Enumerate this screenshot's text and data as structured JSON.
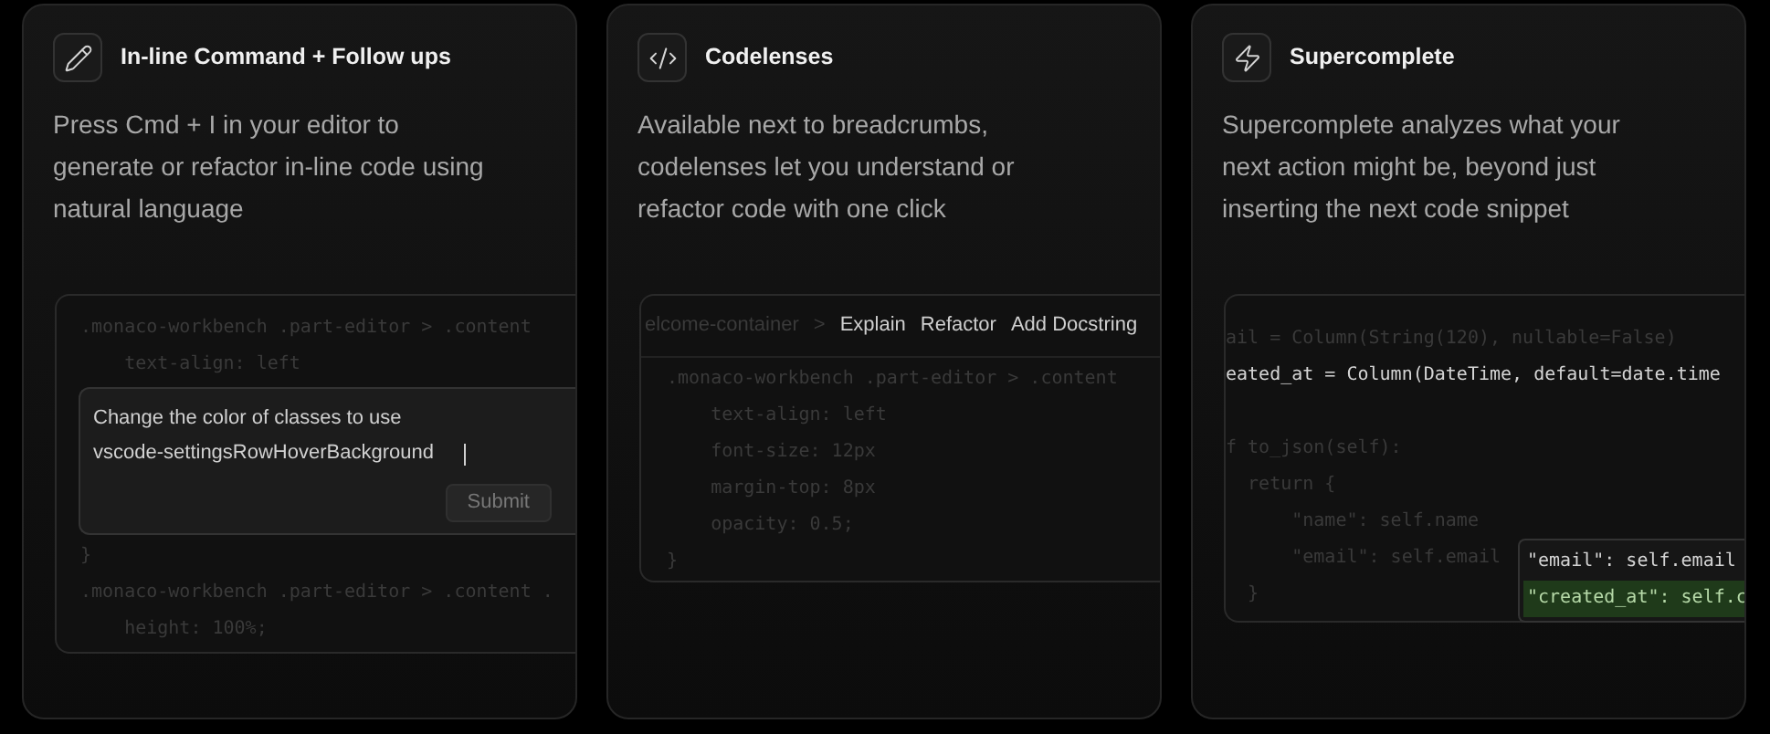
{
  "cards": [
    {
      "kind": "inline_command",
      "title": "In-line Command + Follow ups",
      "description": "Press Cmd + I in your editor to generate or refactor in-line code using natural language",
      "preview": {
        "code_before": [
          ".monaco-workbench .part-editor > .content",
          "    text-align: left"
        ],
        "prompt": {
          "text": "Change the color of classes to use vscode-settingsRowHoverBackground",
          "button": "Submit"
        },
        "code_after": [
          "}",
          ".monaco-workbench .part-editor > .content .",
          "    height: 100%;"
        ]
      }
    },
    {
      "kind": "codelenses",
      "title": "Codelenses",
      "description": "Available next to breadcrumbs, codelenses let you understand or refactor code with one click",
      "preview": {
        "breadcrumb": "elcome-container",
        "separator": ">",
        "actions": [
          "Explain",
          "Refactor",
          "Add Docstring"
        ],
        "code": [
          ".monaco-workbench .part-editor > .content",
          "    text-align: left",
          "    font-size: 12px",
          "    margin-top: 8px",
          "    opacity: 0.5;",
          "}"
        ]
      }
    },
    {
      "kind": "supercomplete",
      "title": "Supercomplete",
      "description": "Supercomplete analyzes what your next action might be, beyond just inserting the next code snippet",
      "preview": {
        "code_blocks": [
          [
            {
              "text": "ail = Column(String(120), nullable=False)",
              "highlighted": false
            },
            {
              "text": "eated_at = Column(DateTime, default=date.time",
              "highlighted": true
            }
          ],
          [
            {
              "text": "f to_json(self):",
              "highlighted": false
            },
            {
              "text": "  return {",
              "highlighted": false
            },
            {
              "text": "      \"name\": self.name",
              "highlighted": false
            },
            {
              "text": "      \"email\": self.email",
              "highlighted": false
            },
            {
              "text": "  }",
              "highlighted": false
            }
          ]
        ],
        "suggestions": [
          {
            "text": "\"email\": self.email",
            "selected": false
          },
          {
            "text": "\"created_at\": self.c",
            "selected": true
          }
        ]
      }
    }
  ]
}
